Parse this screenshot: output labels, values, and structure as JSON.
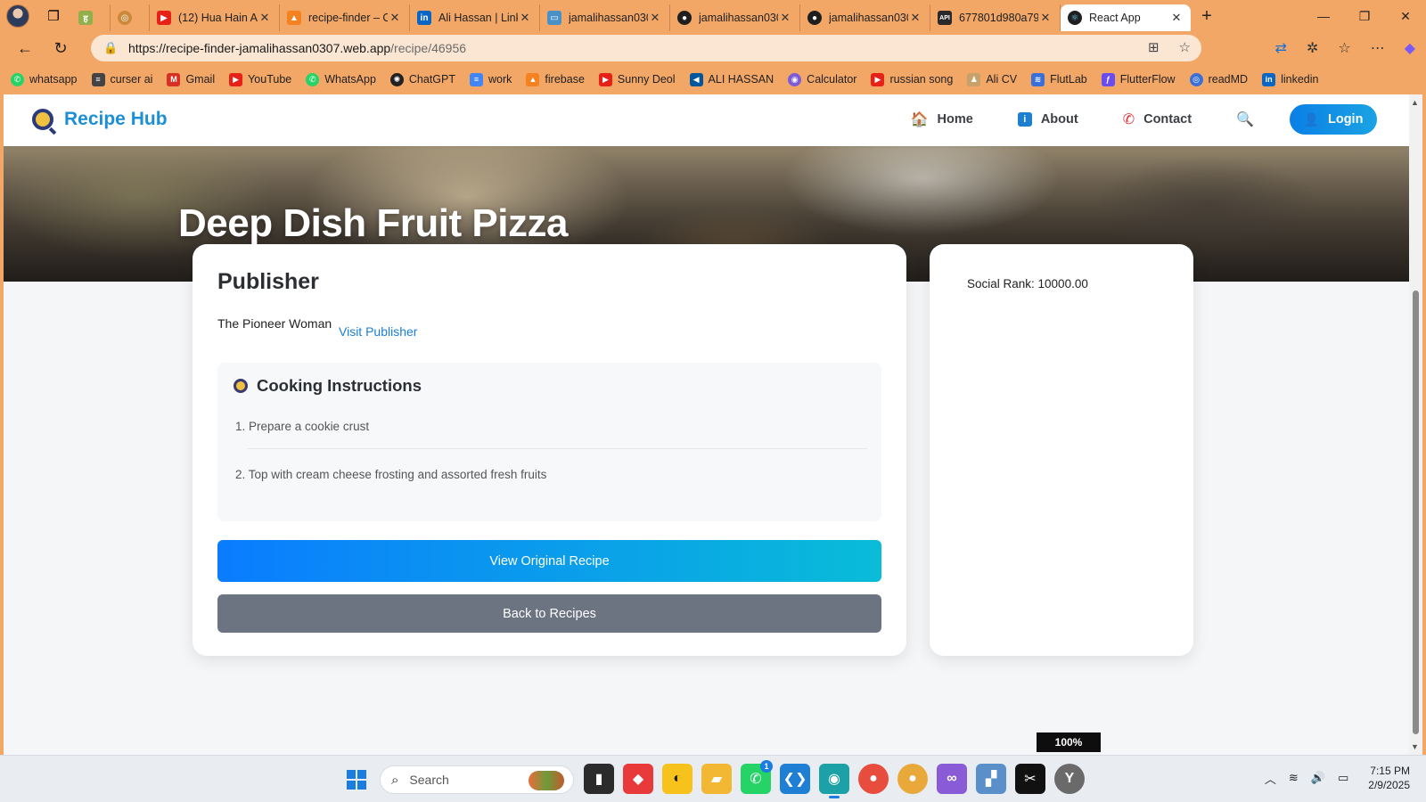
{
  "browser": {
    "tabs": [
      {
        "title": "",
        "favicon": "hindi-h-icon",
        "color": "#8fb04a"
      },
      {
        "title": "",
        "favicon": "circle-icon",
        "color": "#c98a3a"
      },
      {
        "title": "(12) Hua Hain Aa",
        "favicon": "youtube-icon",
        "color": "#e62117"
      },
      {
        "title": "recipe-finder – C",
        "favicon": "firebase-icon",
        "color": "#f58220"
      },
      {
        "title": "Ali Hassan | Link",
        "favicon": "linkedin-icon",
        "color": "#0a66c2"
      },
      {
        "title": "jamalihassan030",
        "favicon": "monitor-icon",
        "color": "#4a90c8"
      },
      {
        "title": "jamalihassan030",
        "favicon": "github-icon",
        "color": "#1f1f1f"
      },
      {
        "title": "jamalihassan030",
        "favicon": "github-icon",
        "color": "#1f1f1f"
      },
      {
        "title": "677801d980a79",
        "favicon": "api-icon",
        "color": "#2a2a2a"
      },
      {
        "title": "React App",
        "favicon": "react-icon",
        "color": "#1f1f1f"
      }
    ],
    "url_host": "https://recipe-finder-jamalihassan0307.web.app",
    "url_path": "/recipe/46956",
    "bookmarks": [
      {
        "label": "whatsapp",
        "color": "#25d366"
      },
      {
        "label": "curser ai",
        "color": "#444444"
      },
      {
        "label": "Gmail",
        "color": "#d93025"
      },
      {
        "label": "YouTube",
        "color": "#e62117"
      },
      {
        "label": "WhatsApp",
        "color": "#25d366"
      },
      {
        "label": "ChatGPT",
        "color": "#222222"
      },
      {
        "label": "work",
        "color": "#4285f4"
      },
      {
        "label": "firebase",
        "color": "#f58220"
      },
      {
        "label": "Sunny Deol",
        "color": "#e62117"
      },
      {
        "label": "ALI HASSAN",
        "color": "#02569b"
      },
      {
        "label": "Calculator",
        "color": "#7b5cd6"
      },
      {
        "label": "russian song",
        "color": "#e62117"
      },
      {
        "label": "Ali CV",
        "color": "#c8a06a"
      },
      {
        "label": "FlutLab",
        "color": "#3a6fd8"
      },
      {
        "label": "FlutterFlow",
        "color": "#6a4cf0"
      },
      {
        "label": "readMD",
        "color": "#3a6fd8"
      },
      {
        "label": "linkedin",
        "color": "#0a66c2"
      }
    ],
    "zoom": "100%"
  },
  "app": {
    "brand": "Recipe Hub",
    "nav": {
      "home": "Home",
      "about": "About",
      "contact": "Contact",
      "login": "Login"
    },
    "recipe": {
      "title": "Deep Dish Fruit Pizza",
      "publisher_heading": "Publisher",
      "publisher_name": "The Pioneer Woman",
      "visit_publisher": "Visit Publisher",
      "instructions_heading": "Cooking Instructions",
      "steps": [
        "1. Prepare a cookie crust",
        "2. Top with cream cheese frosting and assorted fresh fruits"
      ],
      "view_original": "View Original Recipe",
      "back": "Back to Recipes",
      "social_rank": "Social Rank: 10000.00"
    }
  },
  "taskbar": {
    "search_placeholder": "Search",
    "time": "7:15 PM",
    "date": "2/9/2025",
    "whatsapp_badge": "1"
  },
  "colors": {
    "chrome": "#f2a766",
    "accent": "#1a7fd8",
    "button_gradient_start": "#0a7cff",
    "button_gradient_end": "#09bcd8",
    "back_button": "#6b7480"
  }
}
